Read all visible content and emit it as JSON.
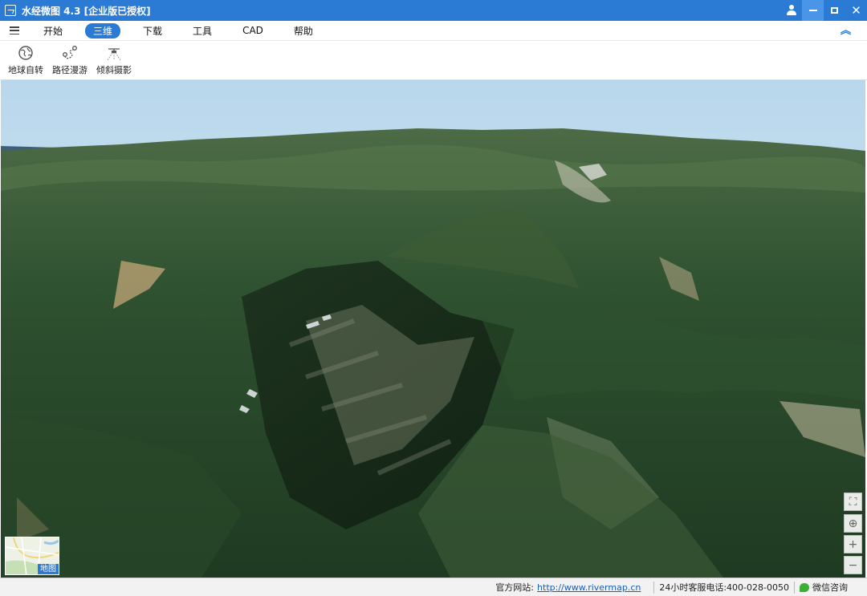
{
  "window": {
    "title": "水经微图 4.3 [企业版已授权]"
  },
  "menu": {
    "items": [
      {
        "label": "开始"
      },
      {
        "label": "三维",
        "active": true
      },
      {
        "label": "下载"
      },
      {
        "label": "工具"
      },
      {
        "label": "CAD"
      },
      {
        "label": "帮助"
      }
    ]
  },
  "toolbar": {
    "tools": [
      {
        "label": "地球自转",
        "icon": "globe-rotate-icon"
      },
      {
        "label": "路径漫游",
        "icon": "path-roam-icon"
      },
      {
        "label": "倾斜摄影",
        "icon": "oblique-photo-icon"
      }
    ]
  },
  "map": {
    "minimap_label": "地图",
    "controls": [
      {
        "icon": "fullscreen-icon",
        "glyph": "⛶"
      },
      {
        "icon": "locate-icon",
        "glyph": "⊕"
      },
      {
        "icon": "zoom-in-icon",
        "glyph": "+"
      },
      {
        "icon": "zoom-out-icon",
        "glyph": "−"
      }
    ]
  },
  "status": {
    "website_label": "官方网站:",
    "website_url": "http://www.rivermap.cn",
    "hotline": "24小时客服电话:400-028-0050",
    "wechat": "微信咨询"
  },
  "colors": {
    "accent": "#2b7bd5",
    "sky": "#cfe4f2",
    "terrain": "#2f5230"
  }
}
